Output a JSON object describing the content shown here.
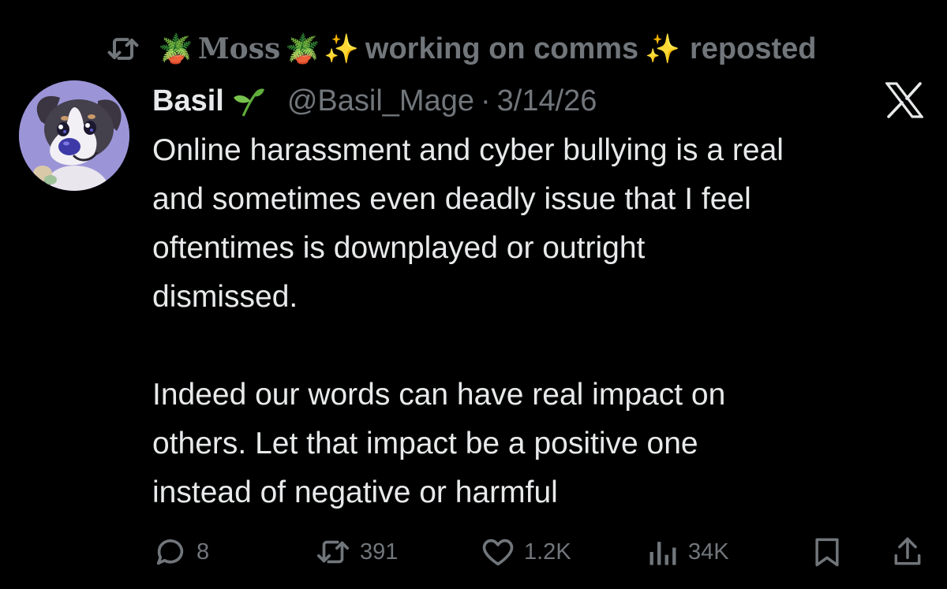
{
  "repost": {
    "icon": "retweet-icon",
    "leading_emoji": "🪴",
    "reposter_name": "Moss",
    "trailing_emoji": "🪴",
    "sparkle_left": "✨",
    "status_text": "working on comms",
    "sparkle_right": "✨",
    "label": "reposted"
  },
  "tweet": {
    "display_name": "Basil",
    "name_icon": "sprout-icon",
    "handle": "@Basil_Mage",
    "separator": "·",
    "date": "3/14/26",
    "brand_icon": "x-logo-icon",
    "text": "Online harassment and cyber bullying is a real\nand sometimes even deadly issue that I feel\noftentimes is downplayed or outright\ndismissed.\n\nIndeed our words can have real impact on\nothers. Let that impact be a positive one\ninstead of negative or harmful"
  },
  "actions": {
    "replies": "8",
    "reposts": "391",
    "likes": "1.2K",
    "views": "34K"
  },
  "colors": {
    "background": "#000000",
    "text_primary": "#e7e9ea",
    "text_secondary": "#71767b",
    "avatar_bg": "#9b95d8"
  }
}
